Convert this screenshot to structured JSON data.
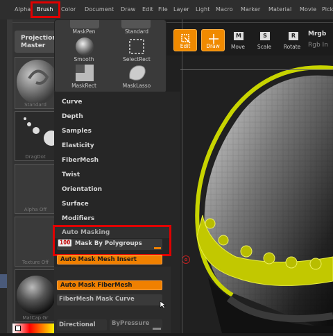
{
  "menu": [
    "Alpha",
    "Brush",
    "Color",
    "Document",
    "Draw",
    "Edit",
    "File",
    "Layer",
    "Light",
    "Macro",
    "Marker",
    "Material",
    "Movie",
    "Pick"
  ],
  "projection_master": {
    "line1": "Projection",
    "line2": "Master"
  },
  "thumbs": {
    "standard": "Standard",
    "dragdot": "DragDot",
    "alpha": "Alpha Off",
    "texture": "Texture Off",
    "matcap": "MatCap Gr"
  },
  "brush_popup": [
    {
      "label": "MaskPen"
    },
    {
      "label": "Standard"
    },
    {
      "label": "Smooth"
    },
    {
      "label": "SelectRect"
    },
    {
      "label": "MaskRect"
    },
    {
      "label": "MaskLasso"
    }
  ],
  "toolbar": {
    "edit": "Edit",
    "draw": "Draw",
    "move": "Move",
    "scale": "Scale",
    "rotate": "Rotate",
    "mrgb": "Mrgb",
    "rgb_int": "Rgb In",
    "m_key": "M",
    "s_key": "S",
    "r_key": "R"
  },
  "brush_menu": [
    "Curve",
    "Depth",
    "Samples",
    "Elasticity",
    "FiberMesh",
    "Twist",
    "Orientation",
    "Surface",
    "Modifiers"
  ],
  "auto_masking": {
    "title": "Auto Masking",
    "polygroups_value": "100",
    "polygroups_label": "Mask By Polygroups",
    "mesh_insert": "Auto Mask Mesh Insert",
    "fibermesh": "Auto Mask FiberMesh",
    "fibermesh_curve": "FiberMesh Mask Curve",
    "directional": "Directional",
    "bypressure": "ByPressure"
  },
  "colors": {
    "accent": "#f08a00",
    "highlight": "#e00000",
    "mesh_yellow": "#c8d400"
  }
}
